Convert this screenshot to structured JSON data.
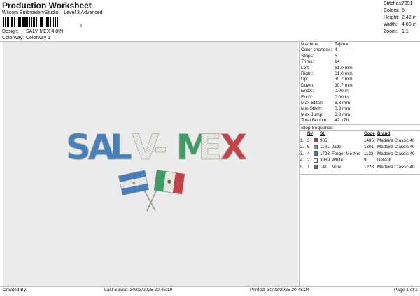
{
  "header": {
    "title": "Production Worksheet",
    "subtitle": "Wilcom EmbroideryStudio – Level 3 Advanced",
    "barcode_suffix": "8",
    "design_label": "Design:",
    "design_value": "SALV MEX 4,8IN",
    "colorway_label": "Colorway:",
    "colorway_value": "Colorway 1"
  },
  "summary": [
    {
      "label": "Stitches:",
      "value": "7391"
    },
    {
      "label": "Colors:",
      "value": "5"
    },
    {
      "label": "Height:",
      "value": "2.42 in"
    },
    {
      "label": "Width:",
      "value": "4.80 in"
    },
    {
      "label": "Zoom:",
      "value": "1:1"
    }
  ],
  "machine": [
    {
      "label": "Machine:",
      "value": "Tajima"
    },
    {
      "label": "Color changes:",
      "value": "4"
    },
    {
      "label": "Stops:",
      "value": "5"
    },
    {
      "label": "Trims:",
      "value": "14"
    },
    {
      "label": "Left:",
      "value": "61.0 mm"
    },
    {
      "label": "Right:",
      "value": "61.0 mm"
    },
    {
      "label": "Up:",
      "value": "30.7 mm"
    },
    {
      "label": "Down:",
      "value": "30.7 mm"
    },
    {
      "label": "EndX:",
      "value": "0.00 in"
    },
    {
      "label": "EndY:",
      "value": "0.00 in"
    },
    {
      "label": "Max Stitch:",
      "value": "6.8 mm"
    },
    {
      "label": "Min Stitch:",
      "value": "0.3 mm"
    },
    {
      "label": "Max Jump:",
      "value": "6.8 mm"
    },
    {
      "label": "Total Bobbin:",
      "value": "42.17ft."
    }
  ],
  "stop_sequence": {
    "title": "Stop Sequence:",
    "headers": {
      "n": "N#",
      "st": "St.",
      "code": "Code",
      "brand": "Brand"
    },
    "rows": [
      {
        "stop": "1.",
        "n": "3",
        "color": "#c8323a",
        "st": "905",
        "name": "",
        "code": "1485",
        "brand": "Madeira Classic 40"
      },
      {
        "stop": "2.",
        "n": "5",
        "color": "#4fae78",
        "st": "1181",
        "name": "Jade",
        "code": "1301",
        "brand": "Madeira Classic 40"
      },
      {
        "stop": "3.",
        "n": "4",
        "color": "#3f7cc4",
        "st": "1793",
        "name": "Forget-Me-Not",
        "code": "1133",
        "brand": "Madeira Classic 40"
      },
      {
        "stop": "4.",
        "n": "2",
        "color": "#f4f4f0",
        "st": "3969",
        "name": "White",
        "code": "9",
        "brand": "Default"
      },
      {
        "stop": "5.",
        "n": "1",
        "color": "#6f6a52",
        "st": "141",
        "name": "Mink",
        "code": "1228",
        "brand": "Madeira Classic 40"
      }
    ]
  },
  "design": {
    "letters": [
      {
        "char": "S",
        "color": "#4a86c4"
      },
      {
        "char": "A",
        "color": "#4a86c4"
      },
      {
        "char": "L",
        "color": "#4a86c4"
      },
      {
        "char": "V",
        "color": "#eef0ea"
      },
      {
        "char": "-",
        "color": "#eef0ea"
      },
      {
        "char": "M",
        "color": "#3fa36a"
      },
      {
        "char": "E",
        "color": "#eef0ea"
      },
      {
        "char": "X",
        "color": "#d0434a"
      }
    ]
  },
  "footer": {
    "created_by": "Created By:",
    "last_saved": "Last Saved: 30/03/2025 20:45:19",
    "printed": "Printed: 30/03/2025 20:45:24",
    "page": "Page 1 of 1"
  }
}
